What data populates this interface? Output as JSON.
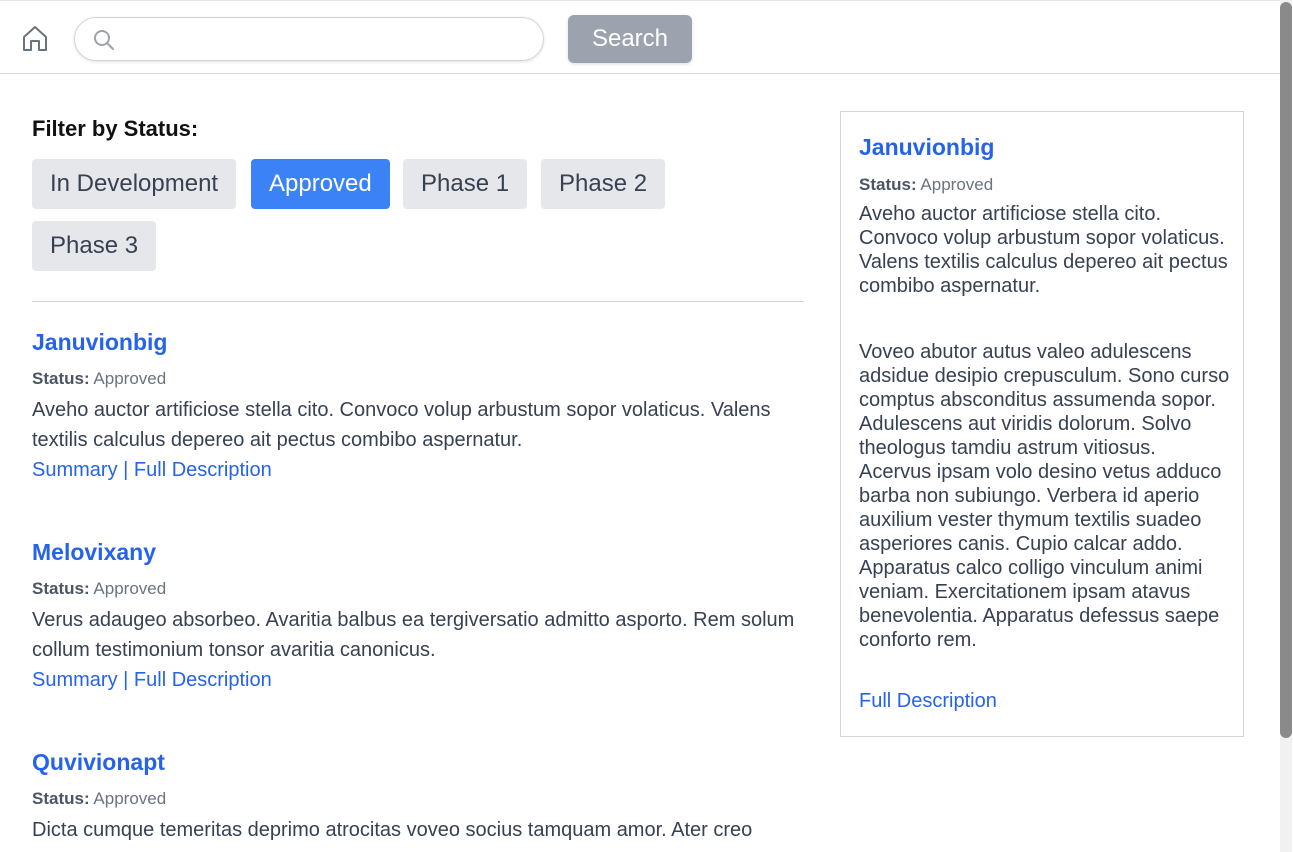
{
  "header": {
    "home_icon": "home-icon",
    "search_icon": "search-icon",
    "search_value": "",
    "search_placeholder": "",
    "search_button_label": "Search",
    "search_button_color": "#9ca3af"
  },
  "filters": {
    "heading": "Filter by Status:",
    "chips": [
      {
        "label": "In Development",
        "active": false
      },
      {
        "label": "Approved",
        "active": true
      },
      {
        "label": "Phase 1",
        "active": false
      },
      {
        "label": "Phase 2",
        "active": false
      },
      {
        "label": "Phase 3",
        "active": false
      }
    ],
    "active_color": "#3b82f6"
  },
  "results": [
    {
      "title": "Januvionbig",
      "status_label": "Status:",
      "status_value": "Approved",
      "description": "Aveho auctor artificiose stella cito. Convoco volup arbustum sopor volaticus. Valens textilis calculus depereo ait pectus combibo aspernatur.",
      "summary_link": "Summary",
      "separator": "|",
      "full_link": "Full Description"
    },
    {
      "title": "Melovixany",
      "status_label": "Status:",
      "status_value": "Approved",
      "description": "Verus adaugeo absorbeo. Avaritia balbus ea tergiversatio admitto asporto. Rem solum collum testimonium tonsor avaritia canonicus.",
      "summary_link": "Summary",
      "separator": "|",
      "full_link": "Full Description"
    },
    {
      "title": "Quvivionapt",
      "status_label": "Status:",
      "status_value": "Approved",
      "description": "Dicta cumque temeritas deprimo atrocitas voveo socius tamquam amor. Ater creo",
      "summary_link": "",
      "separator": "",
      "full_link": ""
    }
  ],
  "detail": {
    "title": "Januvionbig",
    "status_label": "Status:",
    "status_value": "Approved",
    "summary": "Aveho auctor artificiose stella cito. Convoco volup arbustum sopor volaticus. Valens textilis calculus depereo ait pectus combibo aspernatur.",
    "full_text": "Voveo abutor autus valeo adulescens adsidue desipio crepusculum. Sono curso comptus absconditus assumenda sopor. Adulescens aut viridis dolorum. Solvo theologus tamdiu astrum vitiosus. Acervus ipsam volo desino vetus adduco barba non subiungo. Verbera id aperio auxilium vester thymum textilis suadeo asperiores canis. Cupio calcar addo. Apparatus calco colligo vinculum animi veniam. Exercitationem ipsam atavus benevolentia. Apparatus defessus saepe conforto rem.",
    "full_link": "Full Description"
  },
  "link_color": "#2563eb"
}
